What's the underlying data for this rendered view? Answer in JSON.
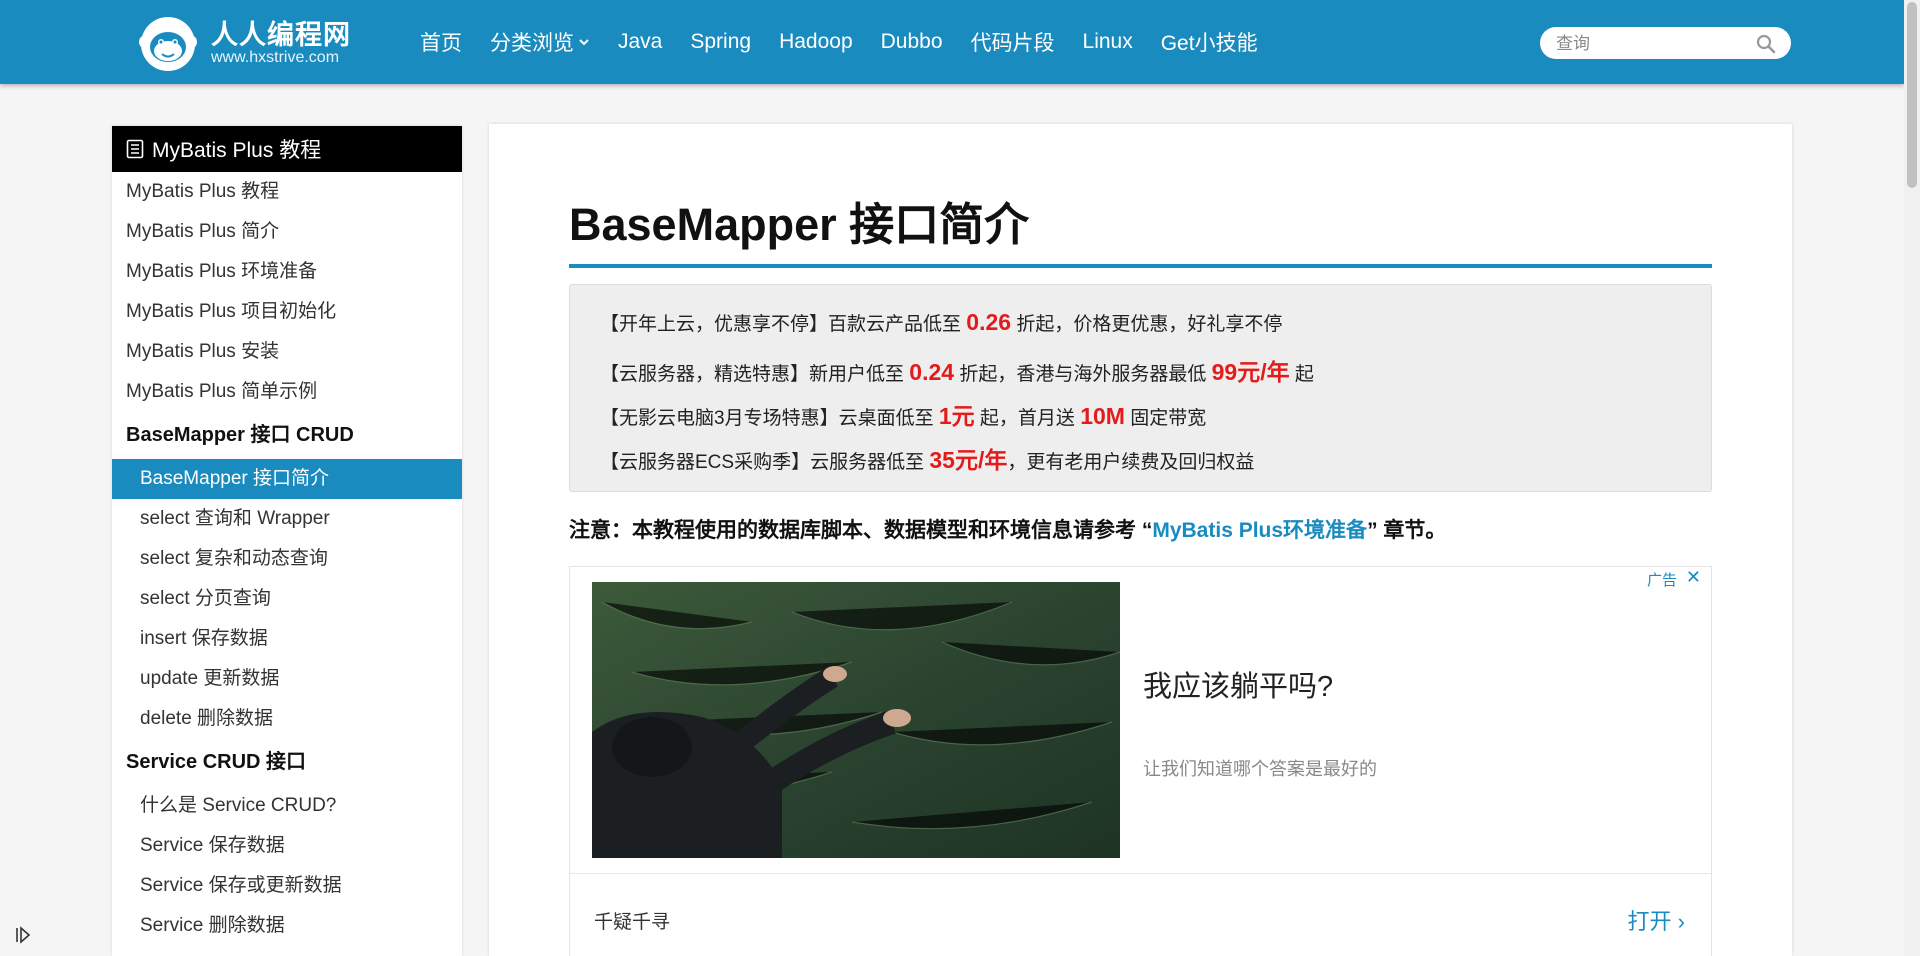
{
  "header": {
    "site_name": "人人编程网",
    "site_url": "www.hxstrive.com",
    "nav": [
      {
        "label": "首页"
      },
      {
        "label": "分类浏览",
        "caret": "⌄"
      },
      {
        "label": "Java"
      },
      {
        "label": "Spring"
      },
      {
        "label": "Hadoop"
      },
      {
        "label": "Dubbo"
      },
      {
        "label": "代码片段"
      },
      {
        "label": "Linux"
      },
      {
        "label": "Get小技能"
      }
    ],
    "search_placeholder": "查询"
  },
  "sidebar": {
    "title": "MyBatis Plus 教程",
    "items": [
      "MyBatis Plus 教程",
      "MyBatis Plus 简介",
      "MyBatis Plus 环境准备",
      "MyBatis Plus 项目初始化",
      "MyBatis Plus 安装",
      "MyBatis Plus 简单示例"
    ],
    "group1": {
      "title": "BaseMapper 接口 CRUD",
      "items": [
        "BaseMapper 接口简介",
        "select 查询和 Wrapper",
        "select 复杂和动态查询",
        "select 分页查询",
        "insert 保存数据",
        "update 更新数据",
        "delete 删除数据"
      ]
    },
    "group2": {
      "title": "Service CRUD 接口",
      "items": [
        "什么是 Service CRUD?",
        "Service 保存数据",
        "Service 保存或更新数据",
        "Service 删除数据"
      ]
    }
  },
  "article": {
    "title": "BaseMapper 接口简介",
    "promo": [
      {
        "a": "【开年上云，优惠享不停】百款云产品低至 ",
        "h1": "0.26",
        "b": " 折起，价格更优惠，好礼享不停",
        "h2": "",
        "c": ""
      },
      {
        "a": "【云服务器，精选特惠】新用户低至 ",
        "h1": "0.24",
        "b": " 折起，香港与海外服务器最低 ",
        "h2": "99元/年",
        "c": " 起"
      },
      {
        "a": "【无影云电脑3月专场特惠】云桌面低至 ",
        "h1": "1元",
        "b": " 起，首月送 ",
        "h2": "10M",
        "c": " 固定带宽"
      },
      {
        "a": "【云服务器ECS采购季】云服务器低至 ",
        "h1": "35元/年",
        "b": "，更有老用户续费及回归权益",
        "h2": "",
        "c": ""
      }
    ],
    "note": {
      "prefix": "注意：本教程使用的数据库脚本、数据模型和环境信息请参考 “",
      "link": "MyBatis Plus环境准备",
      "suffix": "” 章节。"
    },
    "ad": {
      "label": "广告",
      "close": "✕",
      "headline": "我应该躺平吗?",
      "desc": "让我们知道哪个答案是最好的",
      "brand": "千疑千寻",
      "open": "打开 ›"
    }
  },
  "colors": {
    "brand": "#1a8bbf",
    "highlight": "#e31b1b",
    "sidebar_header": "#000000"
  }
}
